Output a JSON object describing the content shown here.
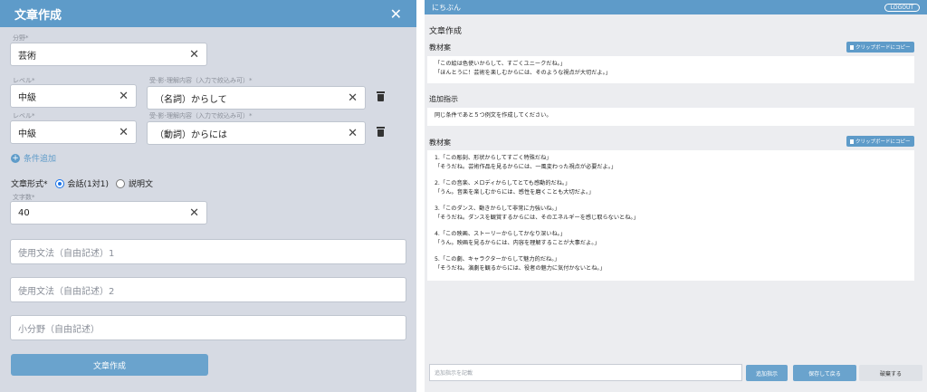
{
  "left": {
    "title": "文章作成",
    "field_label": "分野*",
    "field_value": "芸術",
    "level_label_1": "レベル*",
    "level_value_1": "中級",
    "pattern_label_1": "受-影-理解内容（入力で絞込み可）*",
    "pattern_value_1": "（名詞）からして",
    "level_label_2": "レベル*",
    "level_value_2": "中級",
    "pattern_label_2": "受-影-理解内容（入力で絞込み可）*",
    "pattern_value_2": "（動詞）からには",
    "add_condition": "条件追加",
    "format_label": "文章形式*",
    "format_options": [
      "会話(1対1)",
      "説明文"
    ],
    "char_count_label": "文字数*",
    "char_count_value": "40",
    "grammar1_placeholder": "使用文法（自由記述）1",
    "grammar2_placeholder": "使用文法（自由記述）2",
    "subfield_placeholder": "小分野（自由記述）",
    "submit_label": "文章作成"
  },
  "right": {
    "brand": "にちぶん",
    "logout": "LOGOUT",
    "page_title": "文章作成",
    "draft_label_1": "教材案",
    "copy_label": "クリップボードにコピー",
    "draft1_lines": [
      "「この絵は色使いからして、すごくユニークだね。」",
      "「ほんとうに！芸術を楽しむからには、そのような視点が大切だよ。」"
    ],
    "instruction_label": "追加指示",
    "instruction_text": "同じ条件であと５つ例文を作成してください。",
    "draft_label_2": "教材案",
    "draft2_blocks": [
      [
        "1.「この彫刻、形状からしてすごく特殊だね」",
        "「そうだね。芸術作品を見るからには、一風変わった視点が必要だよ。」"
      ],
      [
        "2.「この音楽、メロディからしてとても感動的だね。」",
        "「うん。音楽を楽しむからには、感性を磨くことも大切だよ。」"
      ],
      [
        "3.「このダンス、動きからして非常に力強いね。」",
        "「そうだね。ダンスを観賞するからには、そのエネルギーを感じ取らないとね。」"
      ],
      [
        "4.「この映画、ストーリーからしてかなり深いね。」",
        "「うん。映画を見るからには、内容を理解することが大事だよ。」"
      ],
      [
        "5.「この劇、キャラクターからして魅力的だね。」",
        "「そうだね。演劇を観るからには、役者の魅力に気付かないとね。」"
      ]
    ],
    "input_placeholder": "追加指示を記載",
    "btn_instruction": "追加指示",
    "btn_save": "保存して戻る",
    "btn_discard": "破棄する"
  },
  "colors": {
    "accent": "#5e9bc9",
    "left_bg": "#d6dae3",
    "right_bg": "#ecedf0"
  },
  "icons": [
    "close-icon",
    "clear-icon",
    "trash-icon",
    "plus-circle-icon",
    "clipboard-icon"
  ]
}
